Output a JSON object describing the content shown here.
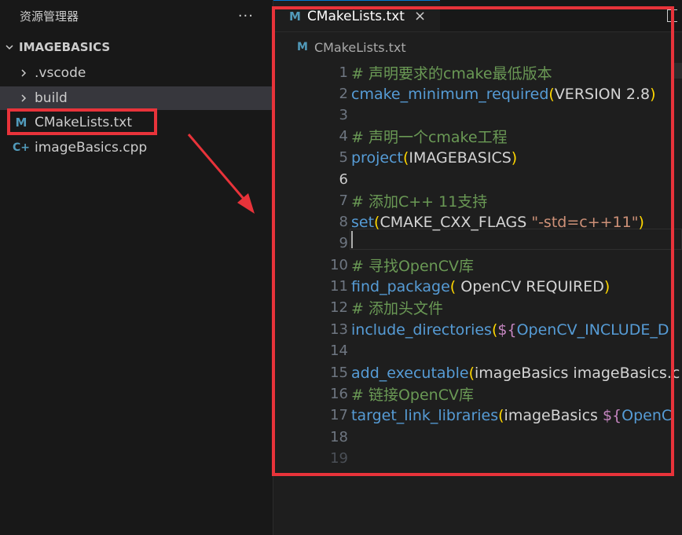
{
  "explorer": {
    "title": "资源管理器",
    "more": "···",
    "folder": "IMAGEBASICS",
    "items": [
      {
        "label": ".vscode",
        "type": "folder"
      },
      {
        "label": "build",
        "type": "folder"
      },
      {
        "label": "CMakeLists.txt",
        "type": "cmake",
        "icon": "M"
      },
      {
        "label": "imageBasics.cpp",
        "type": "cpp",
        "icon": "C+"
      }
    ]
  },
  "tab": {
    "icon": "M",
    "label": "CMakeLists.txt",
    "close": "×"
  },
  "breadcrumb": {
    "icon": "M",
    "label": "CMakeLists.txt"
  },
  "code": {
    "active_line": 6,
    "line_numbers": [
      "1",
      "2",
      "3",
      "4",
      "5",
      "6",
      "7",
      "8",
      "9",
      "10",
      "11",
      "12",
      "13",
      "14",
      "15",
      "16",
      "17",
      "18",
      "19"
    ],
    "l1": "# 声明要求的cmake最低版本",
    "l2_fn": "cmake_minimum_required",
    "l2_open": "(",
    "l2_arg": "VERSION 2.8",
    "l2_close": ")",
    "l4": "# 声明一个cmake工程",
    "l5_fn": "project",
    "l5_open": "(",
    "l5_arg": "IMAGEBASICS",
    "l5_close": ")",
    "l7": "# 添加C++ 11支持",
    "l8_fn": "set",
    "l8_open": "(",
    "l8_arg": "CMAKE_CXX_FLAGS ",
    "l8_str": "\"-std=c++11\"",
    "l8_close": ")",
    "l10": "# 寻找OpenCV库",
    "l11_fn": "find_package",
    "l11_open": "(",
    "l11_arg": " OpenCV REQUIRED",
    "l11_close": ")",
    "l12": "# 添加头文件",
    "l13_fn": "include_directories",
    "l13_open": "(",
    "l13_var": "${",
    "l13_name": "OpenCV_INCLUDE_D",
    "l15_fn": "add_executable",
    "l15_open": "(",
    "l15_arg": "imageBasics imageBasics.c",
    "l16": "# 链接OpenCV库",
    "l17_fn": "target_link_libraries",
    "l17_open": "(",
    "l17_arg": "imageBasics ",
    "l17_var": "${",
    "l17_name": "OpenC"
  },
  "colors": {
    "annotation": "#e8333a",
    "accent": "#519aba"
  }
}
